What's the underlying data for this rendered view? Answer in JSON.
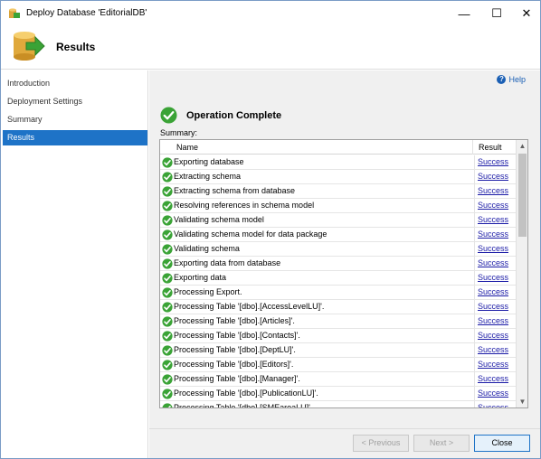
{
  "window": {
    "title": "Deploy Database 'EditorialDB'",
    "controls": {
      "minimize": "—",
      "maximize": "☐",
      "close": "✕"
    }
  },
  "header": {
    "title": "Results"
  },
  "nav": {
    "items": [
      {
        "label": "Introduction"
      },
      {
        "label": "Deployment Settings"
      },
      {
        "label": "Summary"
      },
      {
        "label": "Results"
      }
    ],
    "selected": "Results"
  },
  "content": {
    "help_label": "Help",
    "operation_title": "Operation Complete",
    "summary_label": "Summary:",
    "columns": {
      "name": "Name",
      "result": "Result"
    },
    "rows": [
      {
        "name": "Exporting database",
        "result": "Success"
      },
      {
        "name": "Extracting schema",
        "result": "Success"
      },
      {
        "name": "Extracting schema from database",
        "result": "Success"
      },
      {
        "name": "Resolving references in schema model",
        "result": "Success"
      },
      {
        "name": "Validating schema model",
        "result": "Success"
      },
      {
        "name": "Validating schema model for data package",
        "result": "Success"
      },
      {
        "name": "Validating schema",
        "result": "Success"
      },
      {
        "name": "Exporting data from database",
        "result": "Success"
      },
      {
        "name": "Exporting data",
        "result": "Success"
      },
      {
        "name": "Processing Export.",
        "result": "Success"
      },
      {
        "name": "Processing Table '[dbo].[AccessLevelLU]'.",
        "result": "Success"
      },
      {
        "name": "Processing Table '[dbo].[Articles]'.",
        "result": "Success"
      },
      {
        "name": "Processing Table '[dbo].[Contacts]'.",
        "result": "Success"
      },
      {
        "name": "Processing Table '[dbo].[DeptLU]'.",
        "result": "Success"
      },
      {
        "name": "Processing Table '[dbo].[Editors]'.",
        "result": "Success"
      },
      {
        "name": "Processing Table '[dbo].[Manager]'.",
        "result": "Success"
      },
      {
        "name": "Processing Table '[dbo].[PublicationLU]'.",
        "result": "Success"
      },
      {
        "name": "Processing Table '[dbo].[SMEareaLU]'.",
        "result": "Success"
      }
    ]
  },
  "footer": {
    "previous_label": "< Previous",
    "next_label": "Next >",
    "close_label": "Close"
  },
  "colors": {
    "selection": "#1e73c7",
    "success_check": "#3aa336",
    "link": "#1a1aa6"
  },
  "icons": {
    "app": "database-deploy-icon",
    "header": "database-arrow-icon",
    "operation": "check-circle-icon",
    "row": "check-circle-icon",
    "help": "help-icon"
  }
}
